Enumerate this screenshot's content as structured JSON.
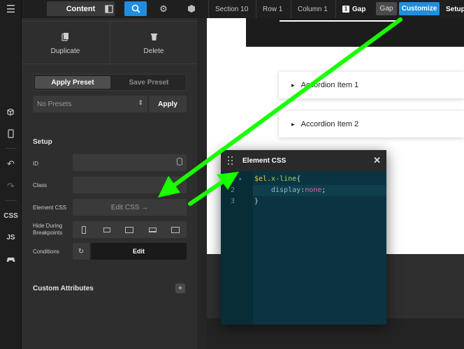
{
  "toolbar": {
    "content_tab": "Content",
    "breadcrumbs": [
      "Section 10",
      "Row 1",
      "Column 1"
    ],
    "current_number": "1",
    "current": "Gap",
    "gap_chip": "Gap",
    "customize": "Customize",
    "setup": "Setup"
  },
  "sidebar": {
    "labels": {
      "css": "CSS",
      "js": "JS"
    }
  },
  "panel": {
    "duplicate": "Duplicate",
    "delete": "Delete",
    "apply_preset": "Apply Preset",
    "save_preset": "Save Preset",
    "no_presets": "No Presets",
    "apply": "Apply",
    "setup_title": "Setup",
    "id_label": "ID",
    "class_label": "Class",
    "element_css_label": "Element CSS",
    "edit_css": "Edit CSS →",
    "hide_label": "Hide During Breakpoints",
    "conditions_label": "Conditions",
    "edit": "Edit",
    "custom_attributes": "Custom Attributes",
    "plus": "+"
  },
  "canvas": {
    "accordion_items": [
      "Accordion Item 1",
      "Accordion Item 2"
    ]
  },
  "modal": {
    "title": "Element CSS",
    "line_numbers": [
      "1",
      "2",
      "3"
    ],
    "code": {
      "var": "$el",
      "selector": ".x-line",
      "open_brace": "{",
      "property": "display",
      "colon": ":",
      "value": "none",
      "semicolon": ";",
      "close_brace": "}"
    }
  },
  "colors": {
    "accent": "#1e8ee0",
    "annotation_arrow": "#19ff00",
    "editor_bg": "#0b3440"
  }
}
